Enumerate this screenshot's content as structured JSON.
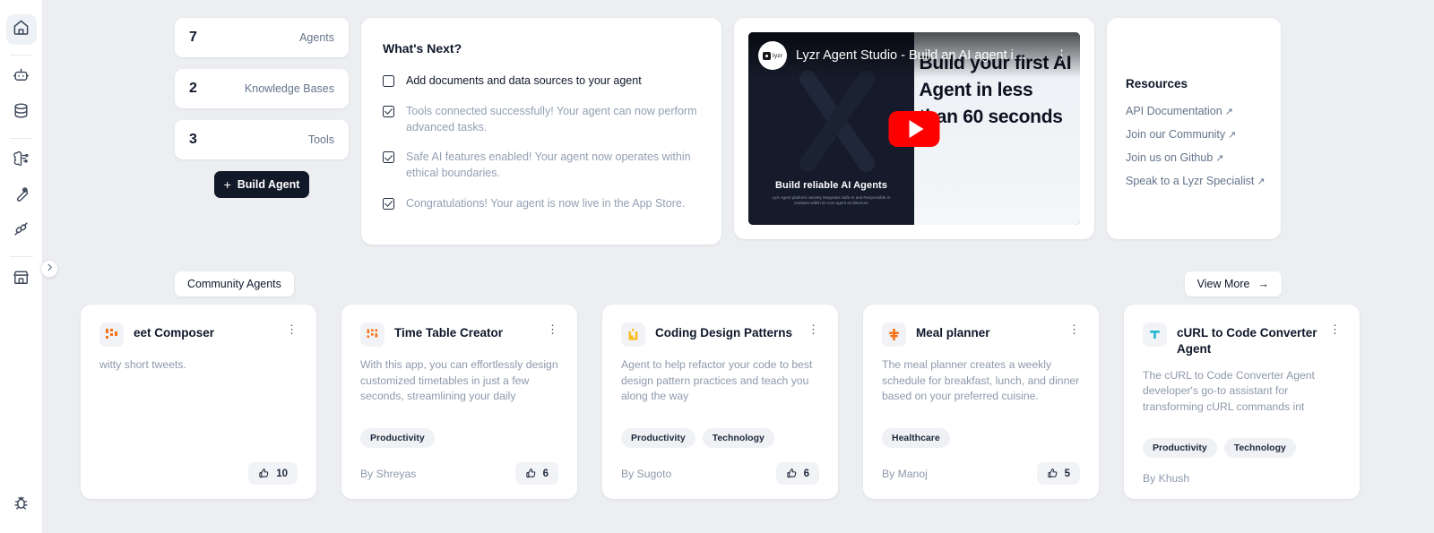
{
  "sidebar": {
    "items": [
      {
        "name": "home",
        "icon": "home-icon",
        "active": true
      },
      {
        "name": "agents",
        "icon": "bot-icon",
        "active": false
      },
      {
        "name": "knowledge-base",
        "icon": "database-icon",
        "active": false
      },
      {
        "name": "safe-ai",
        "icon": "brain-icon",
        "active": false
      },
      {
        "name": "tools",
        "icon": "wrench-icon",
        "active": false
      },
      {
        "name": "integrations",
        "icon": "plug-icon",
        "active": false
      },
      {
        "name": "app-store",
        "icon": "store-icon",
        "active": false
      }
    ],
    "bottom_item": {
      "name": "debug",
      "icon": "bug-icon"
    },
    "expand_label": "expand-sidebar"
  },
  "stats": [
    {
      "count": "7",
      "label": "Agents"
    },
    {
      "count": "2",
      "label": "Knowledge Bases"
    },
    {
      "count": "3",
      "label": "Tools"
    }
  ],
  "build_button": {
    "label": "Build Agent",
    "plus": "+"
  },
  "whats_next": {
    "title": "What's Next?",
    "items": [
      {
        "text": "Add documents and data sources to your agent",
        "checked": false
      },
      {
        "text": "Tools connected successfully! Your agent can now perform advanced tasks.",
        "checked": true
      },
      {
        "text": "Safe AI features enabled! Your agent now operates within ethical boundaries.",
        "checked": true
      },
      {
        "text": "Congratulations! Your agent is now live in the App Store.",
        "checked": true
      }
    ]
  },
  "video": {
    "title": "Lyzr Agent Studio - Build an AI agent i…",
    "channel_badge": "lyzr",
    "kebab": "⋮",
    "hero_text": "Build your first AI Agent in less than 60 seconds",
    "caption_main": "Build reliable AI Agents",
    "caption_sub": "Lyzr Agent platform natively integrates Safe AI and Responsible AI modules within its core agent architecture"
  },
  "resources": {
    "title": "Resources",
    "links": [
      {
        "label": "API Documentation",
        "arrow": "↗"
      },
      {
        "label": "Join our Community",
        "arrow": "↗"
      },
      {
        "label": "Join us on Github",
        "arrow": "↗"
      },
      {
        "label": "Speak to a Lyzr Specialist",
        "arrow": "↗"
      }
    ]
  },
  "community": {
    "tab_label": "Community Agents",
    "view_more_label": "View More",
    "view_more_arrow": "→",
    "cards": [
      {
        "name": "eet Composer",
        "description": "witty short tweets.",
        "tags": [],
        "author": "",
        "likes": "10",
        "icon_color": "#f97316",
        "kebab": "⋮"
      },
      {
        "name": "Time Table Creator",
        "description": "With this app, you can effortlessly design customized timetables in just a few seconds, streamlining your daily routine…",
        "tags": [
          "Productivity"
        ],
        "author": "By Shreyas",
        "likes": "6",
        "icon_color": "#f97316",
        "kebab": "⋮"
      },
      {
        "name": "Coding Design Patterns",
        "description": "Agent to help refactor your code to best design pattern practices and teach you along the way",
        "tags": [
          "Productivity",
          "Technology"
        ],
        "author": "By Sugoto",
        "likes": "6",
        "icon_color": "#fbbf24",
        "kebab": "⋮"
      },
      {
        "name": "Meal planner",
        "description": "The meal planner creates a weekly schedule for breakfast, lunch, and dinner based on your preferred cuisine.",
        "tags": [
          "Healthcare"
        ],
        "author": "By Manoj",
        "likes": "5",
        "icon_color": "#f97316",
        "kebab": "⋮"
      },
      {
        "name": "cURL to Code Converter Agent",
        "description": "The cURL to Code Converter Agent developer's go-to assistant for transforming cURL commands int",
        "tags": [
          "Productivity",
          "Technology"
        ],
        "author": "By Khush",
        "likes": "",
        "icon_color": "#22b8cf",
        "kebab": "⋮"
      }
    ]
  },
  "colors": {
    "background": "#eceef1",
    "card": "#ffffff",
    "accent_dark": "#111827",
    "muted_text": "#8e99ab",
    "youtube_red": "#ff0000"
  }
}
